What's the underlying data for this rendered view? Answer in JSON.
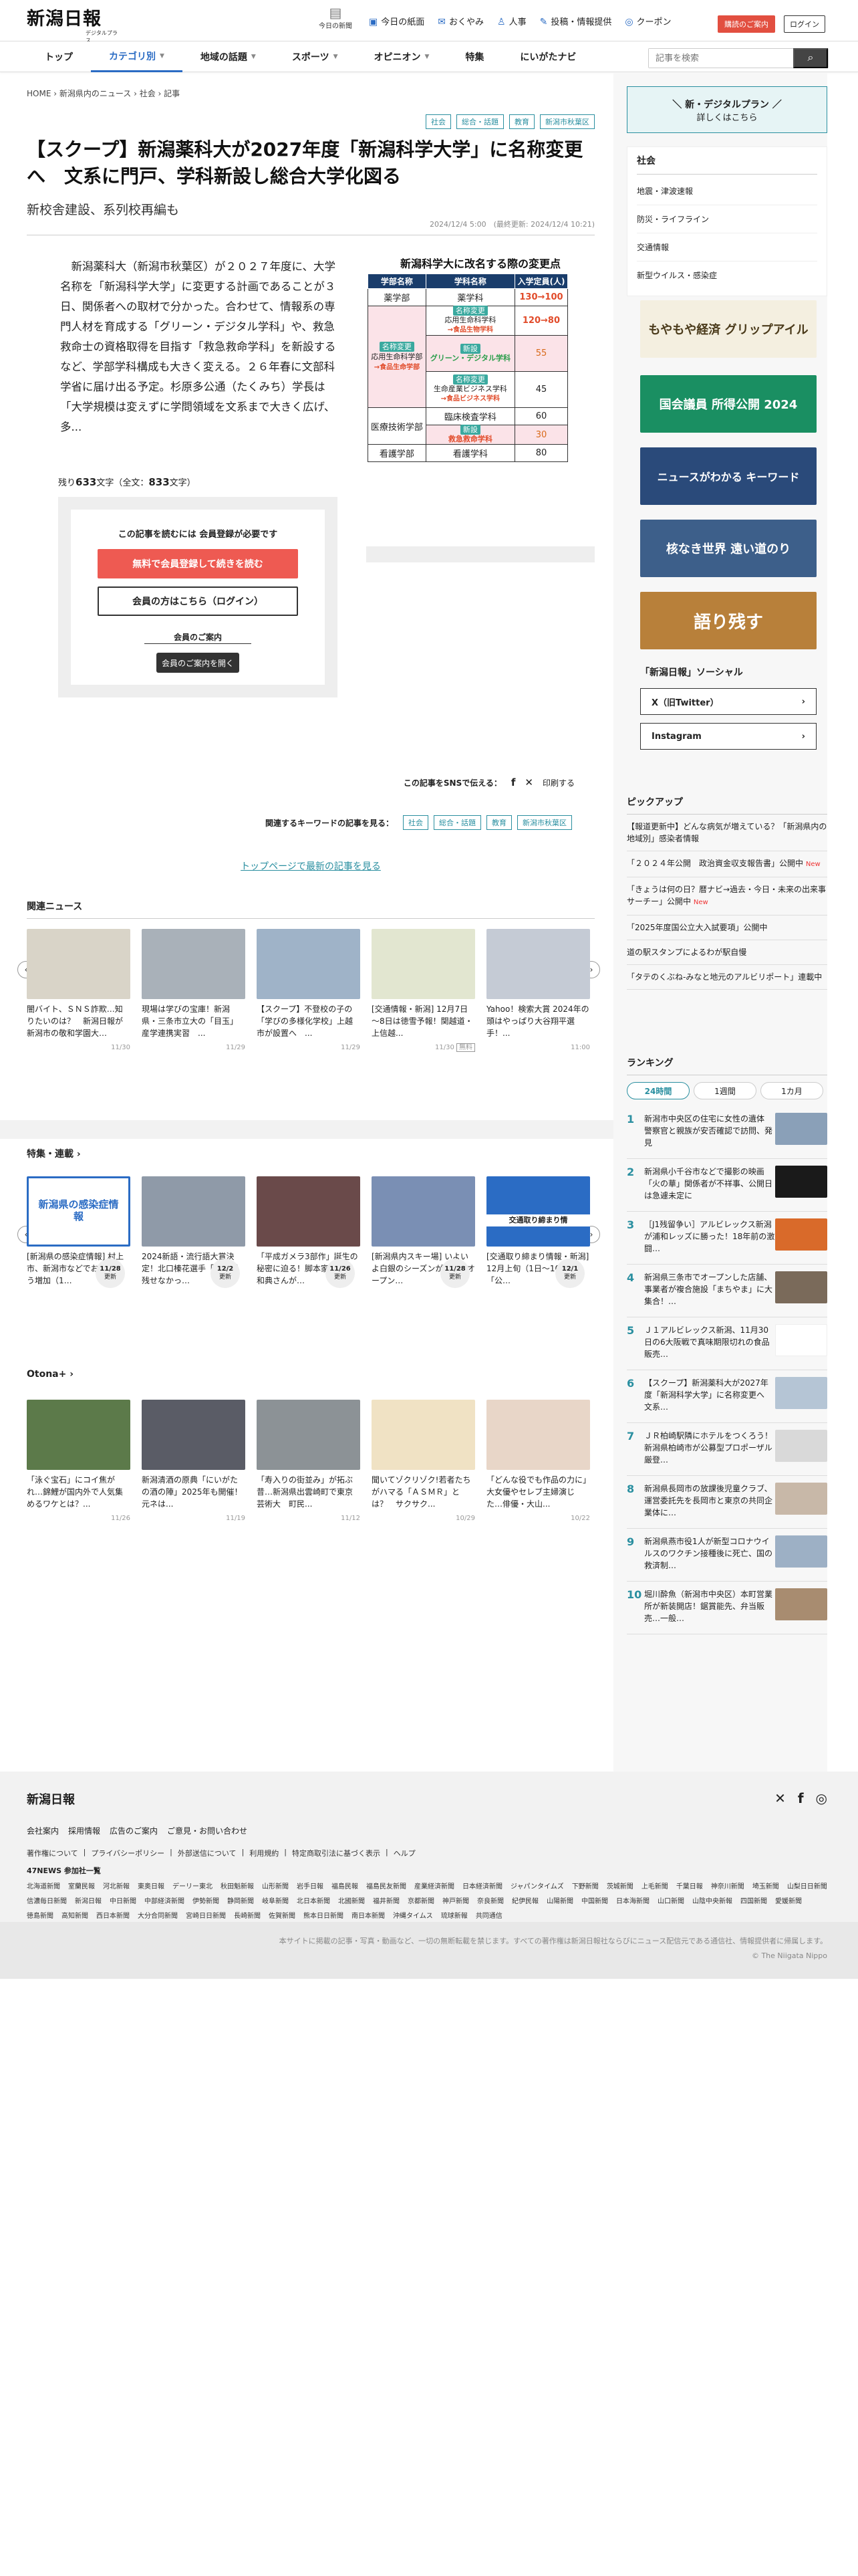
{
  "header": {
    "logo_text": "新潟日報",
    "logo_sub": "デジタルプラス",
    "today_label": "今日の新聞",
    "top_links": [
      {
        "icon": "newspaper-icon",
        "label": "今日の紙面"
      },
      {
        "icon": "condolence-icon",
        "label": "おくやみ"
      },
      {
        "icon": "person-icon",
        "label": "人事"
      },
      {
        "icon": "post-icon",
        "label": "投稿・情報提供"
      },
      {
        "icon": "coupon-icon",
        "label": "クーポン"
      }
    ],
    "pr_button": "購読のご案内",
    "login_button": "ログイン"
  },
  "nav": {
    "items": [
      "トップ",
      "カテゴリ別",
      "地域の話題",
      "スポーツ",
      "オピニオン",
      "特集",
      "にいがたナビ"
    ],
    "search_placeholder": "記事を検索"
  },
  "breadcrumb": [
    "HOME",
    "新潟県内のニュース",
    "社会",
    "記事"
  ],
  "article": {
    "tags": [
      "社会",
      "総合・話題",
      "教育",
      "新潟市秋葉区"
    ],
    "title": "【スクープ】新潟薬科大が2027年度「新潟科学大学」に名称変更へ　文系に門戸、学科新設し総合大学化図る",
    "subtitle": "新校舎建設、系列校再編も",
    "date": "2024/12/4 5:00　(最終更新: 2024/12/4 10:21)",
    "body": "　新潟薬科大（新潟市秋葉区）が２０２７年度に、大学名称を「新潟科学大学」に変更する計画であることが３日、関係者への取材で分かった。合わせて、情報系の専門人材を育成する「グリーン・デジタル学科」や、救急救命士の資格取得を目指す「救急救命学科」を新設するなど、学部学科構成も大きく変える。２６年春に文部科学省に届け出る予定。杉原多公通（たくみち）学長は「大学規模は変えずに学問領域を文系まで大きく広げ、多...",
    "remaining_label": "残り",
    "remaining_chars": "633",
    "remaining_unit": "文字（全文：",
    "total_chars": "833",
    "total_unit": "文字）",
    "figure": {
      "title": "新潟科学大に改名する際の変更点",
      "headers": [
        "学部名称",
        "学科名称",
        "入学定員(人)"
      ],
      "rows": [
        [
          "薬学部",
          "薬学科",
          "130→100"
        ],
        [
          "名称変更",
          "応用生命科学科",
          "120→80"
        ],
        [
          "",
          "グリーン・デジタル学科",
          "55"
        ],
        [
          "",
          "生命産業ビジネス学科",
          "45"
        ],
        [
          "医療技術学部",
          "臨床検査学科",
          "60"
        ],
        [
          "",
          "救急救命学科",
          "30"
        ],
        [
          "看護学部",
          "看護学科",
          "80"
        ]
      ],
      "badges": [
        "名称変更",
        "新設",
        "名称変更",
        "新設"
      ],
      "faculty_note": "応用生命科学部",
      "faculty_arrow": "→食品生命学部",
      "dept_note": "→食品生物学科",
      "dept_note2": "→食品ビジネス学科"
    },
    "paywall": {
      "title": "この記事を読むには 会員登録が必要です",
      "register": "無料で会員登録して続きを読む",
      "login": "会員の方はこちら（ログイン）",
      "guide_title": "会員のご案内",
      "guide_button": "会員のご案内を開く"
    },
    "share_label": "この記事をSNSで伝える：",
    "print_label": "印刷する",
    "related_kw_label": "関連するキーワードの記事を見る：",
    "top_link": "トップページで最新の記事を見る"
  },
  "related": {
    "heading": "関連ニュース",
    "items": [
      {
        "title": "闇バイト、ＳＮＳ詐欺…知りたいのは？　新潟日報が新潟市の敬和学園大…",
        "date": "11/30"
      },
      {
        "title": "現場は学びの宝庫！新潟県・三条市立大の「目玉」産学連携実習　...",
        "date": "11/29"
      },
      {
        "title": "【スクープ】不登校の子の「学びの多様化学校」上越市が設置へ　...",
        "date": "11/29"
      },
      {
        "title": "[交通情報・新潟] 12月7日～8日は徳雪予報！関越道・上信越...",
        "date": "11/30",
        "badge": "無料"
      },
      {
        "title": "Yahoo！検索大賞 2024年の頭はやっぱり大谷翔平選手！...",
        "date": "11:00"
      }
    ]
  },
  "features": {
    "heading": "特集・連載",
    "items": [
      {
        "title": "[新潟県の感染症情報] 村上市、新潟市などでおぼうそう増加（1…",
        "date": "11/28",
        "upd": "更新",
        "img_label": "新潟県の感染症情報"
      },
      {
        "title": "2024新語・流行語大賞決定！北口榛花選手「名言が残せなかっ…",
        "date": "12/2",
        "upd": "更新"
      },
      {
        "title": "「平成ガメラ3部作」誕生の秘密に迫る！脚本家・伊藤和典さんが…",
        "date": "11/26",
        "upd": "更新"
      },
      {
        "title": "[新潟県内スキー場] いよいよ白銀のシーズンが到来♪ オープン…",
        "date": "11/28",
        "upd": "更新"
      },
      {
        "title": "[交通取り締まり情報・新潟] 12月上旬（1日～10日）の「公…",
        "date": "12/1",
        "upd": "更新",
        "img_label": "交通取り締まり情"
      }
    ]
  },
  "otona": {
    "heading": "Otona+",
    "items": [
      {
        "title": "「泳ぐ宝石」にコイ焦がれ…錦鯉が国内外で人気集めるワケとは？...",
        "date": "11/26"
      },
      {
        "title": "新潟清酒の原典「にいがたの酒の陣」2025年も開催！　元ネは...",
        "date": "11/19"
      },
      {
        "title": "「寿入りの街並み」が拓ぶ昔…新潟県出雲崎町で東京芸術大　町民...",
        "date": "11/12"
      },
      {
        "title": "聞いてゾクリゾク!若者たちがハマる「ＡＳＭＲ」とは？　サクサク...",
        "date": "10/29"
      },
      {
        "title": "「どんな役でも作品の力に」大女優やセレブ主婦演じた…俳優・大山...",
        "date": "10/22"
      }
    ]
  },
  "sidebar": {
    "digital_plus": {
      "line1": "＼ 新・デジタルプラン ／",
      "line2": "詳しくはこちら"
    },
    "shakai": {
      "heading": "社会",
      "items": [
        "地震・津波速報",
        "防災・ライフライン",
        "交通情報",
        "新型ウイルス・感染症"
      ]
    },
    "banners": [
      {
        "label": "もやもや経済 グリップアイル",
        "color": "#f4efe0",
        "fg": "#4a3a1a"
      },
      {
        "label": "国会議員 所得公開 2024",
        "color": "#1a8f62",
        "fg": "#ffffff"
      },
      {
        "label": "ニュースがわかる キーワード",
        "color": "#2a4a7a",
        "fg": "#ffffff"
      },
      {
        "label": "核なき世界 遠い道のり",
        "color": "#3d5f8a",
        "fg": "#ffffff"
      },
      {
        "label": "語り残す",
        "color": "#b8803a",
        "fg": "#ffffff"
      }
    ],
    "social": {
      "heading": "「新潟日報」ソーシャル",
      "buttons": [
        "X（旧Twitter）",
        "Instagram"
      ]
    },
    "pickup": {
      "heading": "ピックアップ",
      "items": [
        {
          "text": "【報道更新中】どんな病気が増えている？「新潟県内の地域別」感染者情報"
        },
        {
          "text": "「２０２４年公開　政治資金収支報告書」公開中",
          "new": "New"
        },
        {
          "text": "「きょうは何の日？暦ナビ→過去・今日・未来の出来事サーチー」公開中",
          "new": "New"
        },
        {
          "text": "「2025年度国公立大入試要項」公開中"
        },
        {
          "text": "道の駅スタンプによるわが駅自慢"
        },
        {
          "text": "「タテのくぶね-みなと地元のアルビリポート」連載中"
        }
      ]
    },
    "ranking": {
      "heading": "ランキング",
      "tabs": [
        "24時間",
        "1週間",
        "1カ月"
      ],
      "items": [
        "新潟市中央区の住宅に女性の遺体　警察官と親族が安否確認で訪問、発見",
        "新潟県小千谷市などで撮影の映画「火の華」関係者が不祥事、公開日は急遽未定に",
        "［J1残留争い］アルビレックス新潟が浦和レッズに勝った！18年前の激闘…",
        "新潟県三条市でオープンした店舗、事業者が複合施設「まちやま」に大集合！…",
        "Ｊ１アルビレックス新潟、11月30日の6大阪戦で真味期限切れの食品販売…",
        "【スクープ】新潟薬科大が2027年度「新潟科学大学」に名称変更へ　文系…",
        "ＪＲ柏崎駅隣にホテルをつくろう！新潟県柏崎市が公募型プロポーザル　厳登…",
        "新潟県長岡市の放課後児童クラブ、運営委託先を長岡市と東京の共同企業体に…",
        "新潟県燕市役1人が新型コロナウイルスのワクチン接種後に死亡、国の救済制…",
        "堀川酔魚（新潟市中央区）本町営業所が新装開店！鋸賞能先、弁当販売…一般…"
      ]
    }
  },
  "footer": {
    "logo": "新潟日報",
    "links1": [
      "会社案内",
      "採用情報",
      "広告のご案内",
      "ご意見・お問い合わせ"
    ],
    "links2": [
      "著作権について",
      "プライバシーポリシー",
      "外部送信について",
      "利用規約",
      "特定商取引法に基づく表示",
      "ヘルプ"
    ],
    "news47": "47NEWS 参加社一覧",
    "papers": [
      "北海道新聞",
      "室蘭民報",
      "河北新報",
      "東奥日報",
      "デーリー東北",
      "秋田魁新報",
      "山形新聞",
      "岩手日報",
      "福島民報",
      "福島民友新聞",
      "産業経済新聞",
      "日本経済新聞",
      "ジャパンタイムズ",
      "下野新聞",
      "茨城新聞",
      "上毛新聞",
      "千葉日報",
      "神奈川新聞",
      "埼玉新聞",
      "山梨日日新聞",
      "信濃毎日新聞",
      "新潟日報",
      "中日新聞",
      "中部経済新聞",
      "伊勢新聞",
      "静岡新聞",
      "岐阜新聞",
      "北日本新聞",
      "北國新聞",
      "福井新聞",
      "京都新聞",
      "神戸新聞",
      "奈良新聞",
      "紀伊民報",
      "山陽新聞",
      "中国新聞",
      "日本海新聞",
      "山口新聞",
      "山陰中央新報",
      "四国新聞",
      "愛媛新聞",
      "徳島新聞",
      "高知新聞",
      "西日本新聞",
      "大分合同新聞",
      "宮崎日日新聞",
      "長崎新聞",
      "佐賀新聞",
      "熊本日日新聞",
      "南日本新聞",
      "沖縄タイムス",
      "琉球新報",
      "共同通信"
    ],
    "copyright_note": "本サイトに掲載の記事・写真・動画など、一切の無断転載を禁じます。すべての著作権は新潟日報社ならびにニュース配信元である通信社、情報提供者に帰属します。",
    "copyright": "© The Niigata Nippo"
  }
}
